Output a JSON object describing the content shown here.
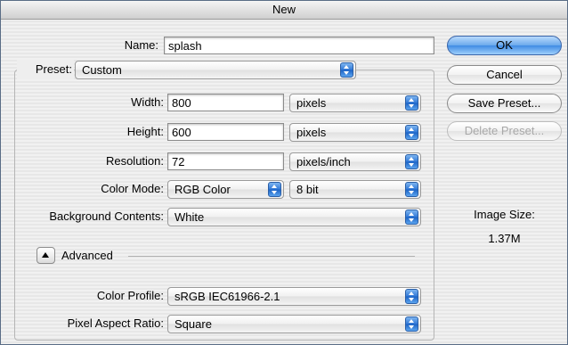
{
  "window": {
    "title": "New"
  },
  "form": {
    "name_label": "Name:",
    "name_value": "splash",
    "preset_label": "Preset:",
    "preset_value": "Custom",
    "width_label": "Width:",
    "width_value": "800",
    "width_unit": "pixels",
    "height_label": "Height:",
    "height_value": "600",
    "height_unit": "pixels",
    "resolution_label": "Resolution:",
    "resolution_value": "72",
    "resolution_unit": "pixels/inch",
    "color_mode_label": "Color Mode:",
    "color_mode_value": "RGB Color",
    "bit_depth_value": "8 bit",
    "background_label": "Background Contents:",
    "background_value": "White",
    "advanced_label": "Advanced",
    "color_profile_label": "Color Profile:",
    "color_profile_value": "sRGB IEC61966-2.1",
    "pixel_aspect_label": "Pixel Aspect Ratio:",
    "pixel_aspect_value": "Square"
  },
  "buttons": {
    "ok": "OK",
    "cancel": "Cancel",
    "save_preset": "Save Preset...",
    "delete_preset": "Delete Preset..."
  },
  "image_size": {
    "label": "Image Size:",
    "value": "1.37M"
  },
  "colors": {
    "default_button": "#6aa9ec",
    "popup_arrows": "#2f77d6",
    "border_frame": "#5a6d86"
  },
  "icons": {
    "popup": "updown-arrows-icon",
    "advanced": "disclosure-triangle-icon"
  }
}
